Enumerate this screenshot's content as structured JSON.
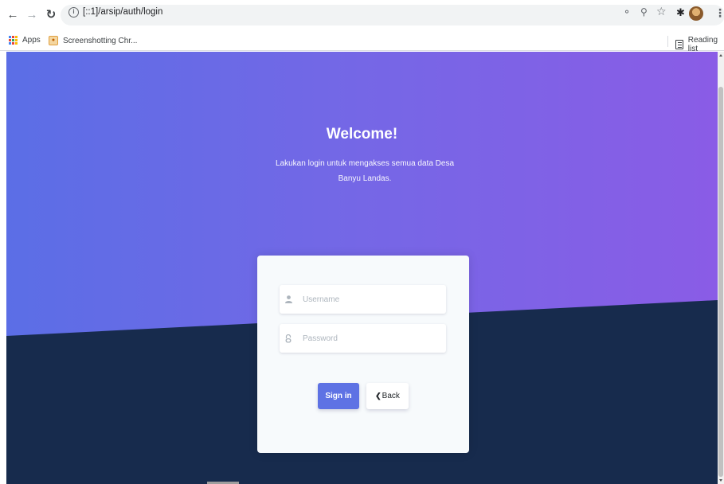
{
  "browser": {
    "url": "[::1]/arsip/auth/login",
    "bookmarks": [
      {
        "label": "Apps",
        "icon": "apps-grid-icon"
      },
      {
        "label": "Screenshotting Chr...",
        "icon": "screenshot-extension-icon"
      }
    ],
    "reading_list": "Reading list"
  },
  "page": {
    "title": "Welcome!",
    "lead": "Lakukan login untuk mengakses semua data Desa Banyu Landas.",
    "username_placeholder": "Username",
    "password_placeholder": "Password",
    "signin_label": "Sign in",
    "back_label": "Back"
  },
  "colors": {
    "gradient_start": "#5b6ee6",
    "gradient_end": "#8a5ce6",
    "dark_section": "#172b4d",
    "primary_button": "#5e72e4"
  }
}
